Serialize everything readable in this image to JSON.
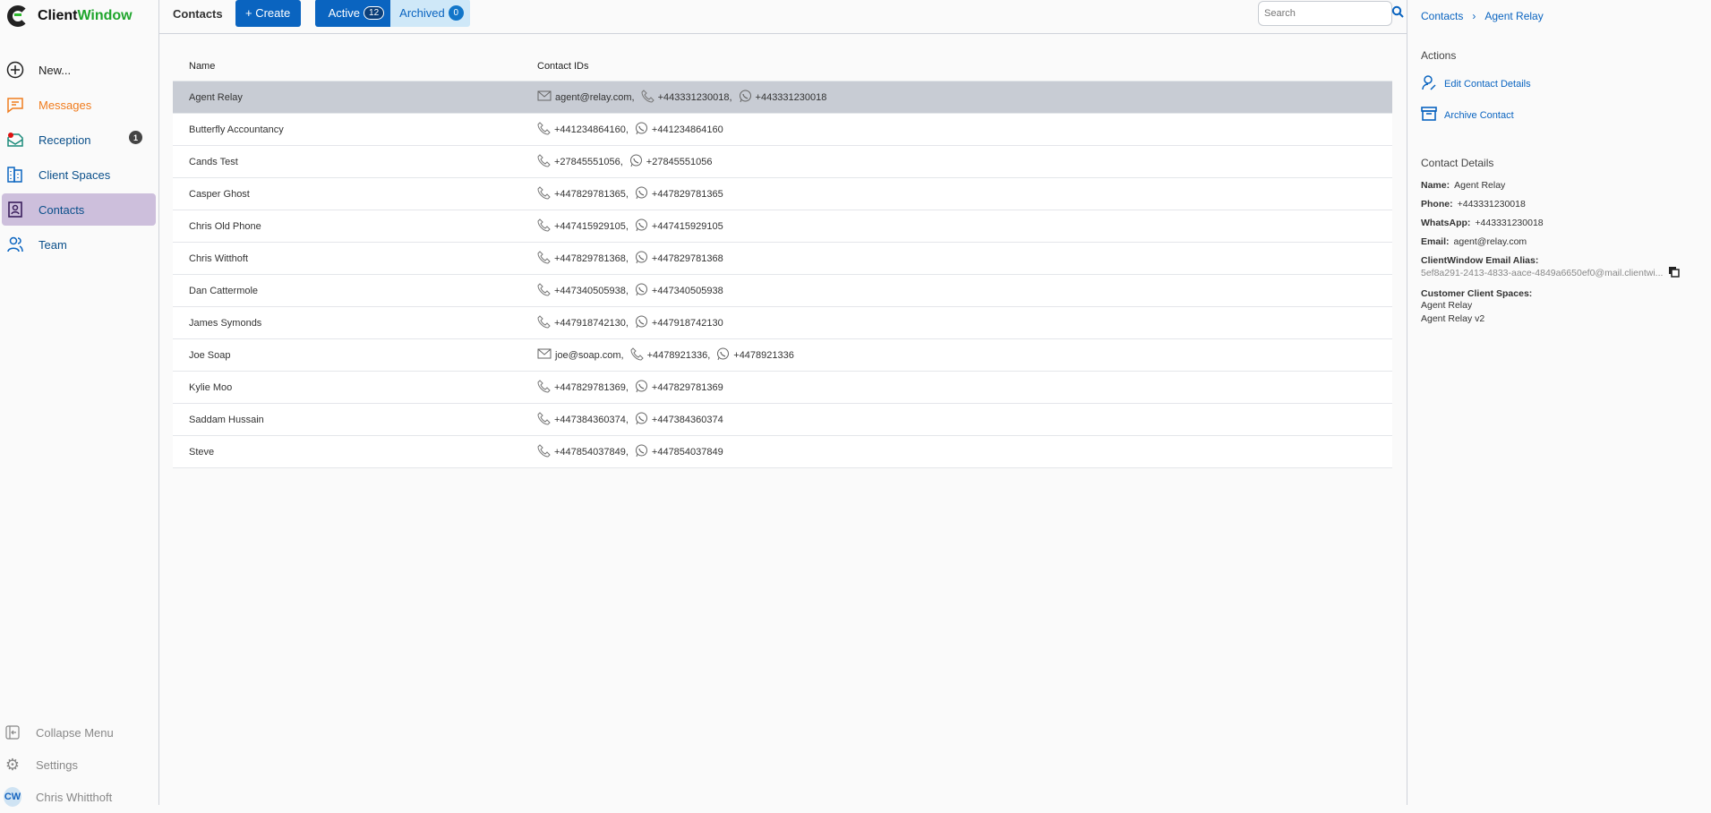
{
  "app": {
    "brand_a": "Client",
    "brand_b": "Window"
  },
  "sidebar": {
    "items": [
      {
        "label": "New...",
        "color": "#222"
      },
      {
        "label": "Messages",
        "color": "#f07c1e"
      },
      {
        "label": "Reception",
        "color": "#0a4f8a",
        "badge": "1"
      },
      {
        "label": "Client Spaces",
        "color": "#0a4f8a"
      },
      {
        "label": "Contacts",
        "color": "#0a4f8a"
      },
      {
        "label": "Team",
        "color": "#0a4f8a"
      }
    ],
    "bottom": {
      "collapse": "Collapse Menu",
      "settings": "Settings",
      "user": "Chris Whitthoft",
      "initials": "CW"
    }
  },
  "header": {
    "title": "Contacts",
    "create": "+ Create",
    "active": "Active",
    "active_count": "12",
    "archived": "Archived",
    "archived_count": "0",
    "search_placeholder": "Search"
  },
  "table": {
    "headers": [
      "Name",
      "Contact IDs"
    ],
    "rows": [
      {
        "name": "Agent Relay",
        "ids": [
          {
            "t": "email",
            "v": "agent@relay.com,"
          },
          {
            "t": "phone",
            "v": "+443331230018,"
          },
          {
            "t": "wa",
            "v": "+443331230018"
          }
        ]
      },
      {
        "name": "Butterfly Accountancy",
        "ids": [
          {
            "t": "phone",
            "v": "+441234864160,"
          },
          {
            "t": "wa",
            "v": "+441234864160"
          }
        ]
      },
      {
        "name": "Cands Test",
        "ids": [
          {
            "t": "phone",
            "v": "+27845551056,"
          },
          {
            "t": "wa",
            "v": "+27845551056"
          }
        ]
      },
      {
        "name": "Casper Ghost",
        "ids": [
          {
            "t": "phone",
            "v": "+447829781365,"
          },
          {
            "t": "wa",
            "v": "+447829781365"
          }
        ]
      },
      {
        "name": "Chris Old Phone",
        "ids": [
          {
            "t": "phone",
            "v": "+447415929105,"
          },
          {
            "t": "wa",
            "v": "+447415929105"
          }
        ]
      },
      {
        "name": "Chris Witthoft",
        "ids": [
          {
            "t": "phone",
            "v": "+447829781368,"
          },
          {
            "t": "wa",
            "v": "+447829781368"
          }
        ]
      },
      {
        "name": "Dan Cattermole",
        "ids": [
          {
            "t": "phone",
            "v": "+447340505938,"
          },
          {
            "t": "wa",
            "v": "+447340505938"
          }
        ]
      },
      {
        "name": "James Symonds",
        "ids": [
          {
            "t": "phone",
            "v": "+447918742130,"
          },
          {
            "t": "wa",
            "v": "+447918742130"
          }
        ]
      },
      {
        "name": "Joe Soap",
        "ids": [
          {
            "t": "email",
            "v": "joe@soap.com,"
          },
          {
            "t": "phone",
            "v": "+4478921336,"
          },
          {
            "t": "wa",
            "v": "+4478921336"
          }
        ]
      },
      {
        "name": "Kylie Moo",
        "ids": [
          {
            "t": "phone",
            "v": "+447829781369,"
          },
          {
            "t": "wa",
            "v": "+447829781369"
          }
        ]
      },
      {
        "name": "Saddam Hussain",
        "ids": [
          {
            "t": "phone",
            "v": "+447384360374,"
          },
          {
            "t": "wa",
            "v": "+447384360374"
          }
        ]
      },
      {
        "name": "Steve",
        "ids": [
          {
            "t": "phone",
            "v": "+447854037849,"
          },
          {
            "t": "wa",
            "v": "+447854037849"
          }
        ]
      }
    ]
  },
  "panel": {
    "crumb_root": "Contacts",
    "crumb_current": "Agent Relay",
    "actions_title": "Actions",
    "edit": "Edit Contact Details",
    "archive": "Archive Contact",
    "details_title": "Contact Details",
    "name_label": "Name:",
    "name": "Agent Relay",
    "phone_label": "Phone:",
    "phone": "+443331230018",
    "wa_label": "WhatsApp:",
    "wa": "+443331230018",
    "email_label": "Email:",
    "email": "agent@relay.com",
    "alias_label": "ClientWindow Email Alias:",
    "alias": "5ef8a291-2413-4833-aace-4849a6650ef0@mail.clientwi...",
    "spaces_label": "Customer Client Spaces:",
    "spaces": [
      "Agent Relay",
      "Agent Relay v2"
    ]
  },
  "colors": {
    "primary": "#0a64c0",
    "selected_row": "#c8ccd4",
    "active_nav": "#cdbfdc"
  }
}
